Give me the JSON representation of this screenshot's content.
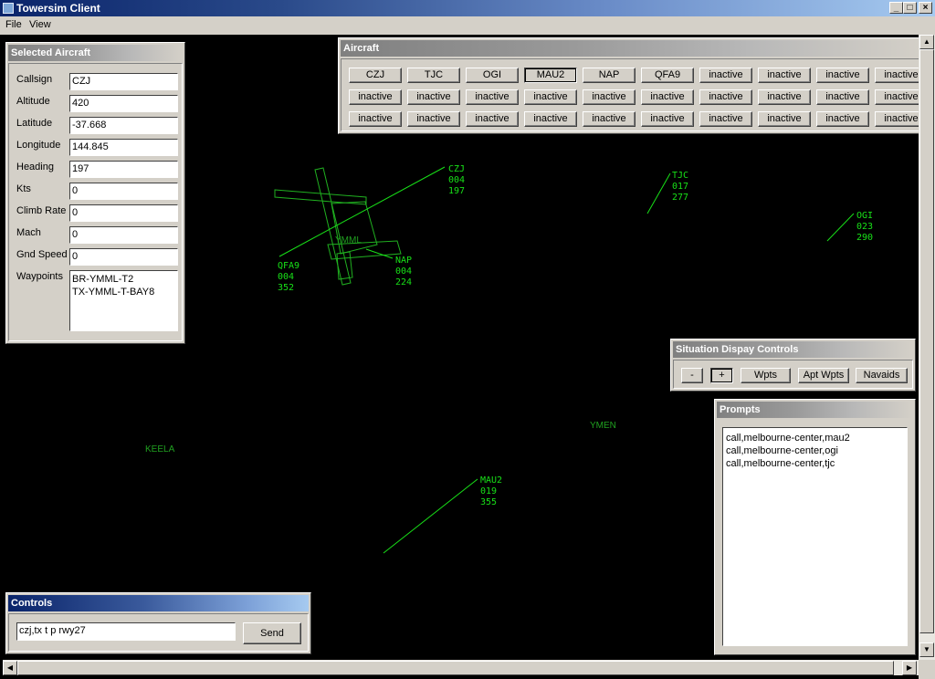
{
  "window": {
    "title": "Towersim Client",
    "min": "_",
    "max": "□",
    "close": "×"
  },
  "menu": [
    "File",
    "View"
  ],
  "selected": {
    "title": "Selected Aircraft",
    "fields": [
      {
        "label": "Callsign",
        "value": "CZJ"
      },
      {
        "label": "Altitude",
        "value": "420"
      },
      {
        "label": "Latitude",
        "value": "-37.668"
      },
      {
        "label": "Longitude",
        "value": "144.845"
      },
      {
        "label": "Heading",
        "value": "197"
      },
      {
        "label": "Kts",
        "value": "0"
      },
      {
        "label": "Climb Rate",
        "value": "0"
      },
      {
        "label": "Mach",
        "value": "0"
      },
      {
        "label": "Gnd Speed",
        "value": "0"
      }
    ],
    "waypoints_label": "Waypoints",
    "waypoints": [
      "BR-YMML-T2",
      "TX-YMML-T-BAY8"
    ]
  },
  "aircraft_panel": {
    "title": "Aircraft",
    "rows": [
      [
        "CZJ",
        "TJC",
        "OGI",
        "MAU2",
        "NAP",
        "QFA9",
        "inactive",
        "inactive",
        "inactive",
        "inactive"
      ],
      [
        "inactive",
        "inactive",
        "inactive",
        "inactive",
        "inactive",
        "inactive",
        "inactive",
        "inactive",
        "inactive",
        "inactive"
      ],
      [
        "inactive",
        "inactive",
        "inactive",
        "inactive",
        "inactive",
        "inactive",
        "inactive",
        "inactive",
        "inactive",
        "inactive"
      ]
    ],
    "selected_button": "MAU2"
  },
  "situation": {
    "title": "Situation Dispay Controls",
    "buttons": [
      "-",
      "+",
      "Wpts",
      "Apt Wpts",
      "Navaids"
    ]
  },
  "prompts": {
    "title": "Prompts",
    "lines": [
      "call,melbourne-center,mau2",
      "call,melbourne-center,ogi",
      "call,melbourne-center,tjc"
    ]
  },
  "controls": {
    "title": "Controls",
    "input_value": "czj,tx t p rwy27",
    "send_label": "Send"
  },
  "radar": {
    "airport": "YMML",
    "fixes": [
      "KEELA",
      "YMEN"
    ],
    "tracks": [
      {
        "callsign": "CZJ",
        "alt": "004",
        "hdg": "197"
      },
      {
        "callsign": "TJC",
        "alt": "017",
        "hdg": "277"
      },
      {
        "callsign": "OGI",
        "alt": "023",
        "hdg": "290"
      },
      {
        "callsign": "QFA9",
        "alt": "004",
        "hdg": "352"
      },
      {
        "callsign": "NAP",
        "alt": "004",
        "hdg": "224"
      },
      {
        "callsign": "MAU2",
        "alt": "019",
        "hdg": "355"
      }
    ]
  },
  "colors": {
    "radar_green": "#18e018",
    "fix_green": "#20a020",
    "background": "#000000"
  }
}
